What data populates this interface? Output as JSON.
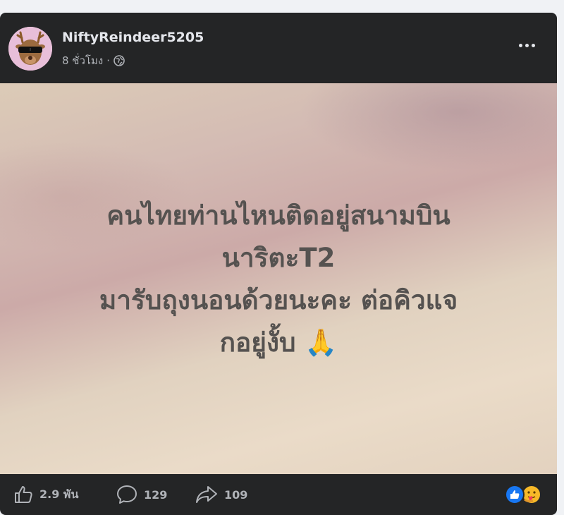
{
  "post": {
    "author": "NiftyReindeer5205",
    "time": "8 ชั่วโมง",
    "separator": "·",
    "text_lines": [
      "คนไทยท่านไหนติดอยู่สนามบิน",
      "นาริตะT2",
      "มารับถุงนอนด้วยนะคะ ต่อคิวแจ",
      "กอยู่งั้บ 🙏"
    ]
  },
  "footer": {
    "likes": "2.9 พัน",
    "comments": "129",
    "shares": "109"
  },
  "icons": {
    "audience": "globe-icon",
    "menu": "more-options-icon",
    "like": "like-icon",
    "comment": "comment-icon",
    "share": "share-icon",
    "reactions": [
      "like-reaction-icon",
      "care-reaction-icon"
    ]
  },
  "colors": {
    "card_bg": "#242526",
    "text_primary": "#e4e6eb",
    "text_secondary": "#b0b3b8",
    "like_blue": "#1877f2"
  }
}
